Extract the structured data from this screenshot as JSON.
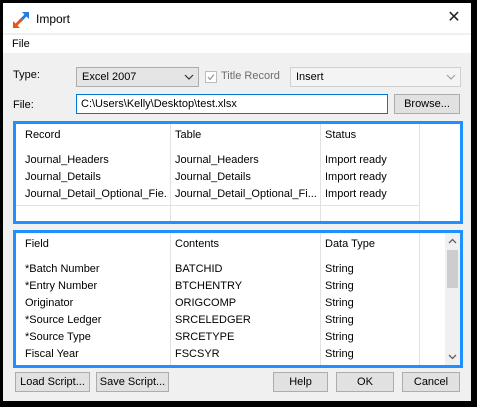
{
  "window": {
    "title": "Import",
    "close_glyph": "✕"
  },
  "menu": {
    "file": "File"
  },
  "form": {
    "type_label": "Type:",
    "type_value": "Excel 2007",
    "title_record_label": "Title Record",
    "mode_value": "Insert",
    "file_label": "File:",
    "file_value": "C:\\Users\\Kelly\\Desktop\\test.xlsx",
    "browse_label": "Browse..."
  },
  "records": {
    "headers": [
      "Record",
      "Table",
      "Status"
    ],
    "rows": [
      [
        "Journal_Headers",
        "Journal_Headers",
        "Import ready"
      ],
      [
        "Journal_Details",
        "Journal_Details",
        "Import ready"
      ],
      [
        "Journal_Detail_Optional_Fie...",
        "Journal_Detail_Optional_Fi...",
        "Import ready"
      ]
    ]
  },
  "fields": {
    "headers": [
      "Field",
      "Contents",
      "Data Type"
    ],
    "rows": [
      [
        "*Batch Number",
        "BATCHID",
        "String"
      ],
      [
        "*Entry Number",
        "BTCHENTRY",
        "String"
      ],
      [
        "Originator",
        "ORIGCOMP",
        "String"
      ],
      [
        "*Source Ledger",
        "SRCELEDGER",
        "String"
      ],
      [
        "*Source Type",
        "SRCETYPE",
        "String"
      ],
      [
        "Fiscal Year",
        "FSCSYR",
        "String"
      ]
    ]
  },
  "buttons": {
    "load_script": "Load Script...",
    "save_script": "Save Script...",
    "help": "Help",
    "ok": "OK",
    "cancel": "Cancel"
  },
  "colors": {
    "highlight_border": "#1e90ff",
    "focus_border": "#0078d7"
  },
  "icons": [
    "import-icon",
    "close-icon",
    "chevron-down-icon",
    "checkmark-icon",
    "scroll-up-icon",
    "scroll-down-icon"
  ]
}
